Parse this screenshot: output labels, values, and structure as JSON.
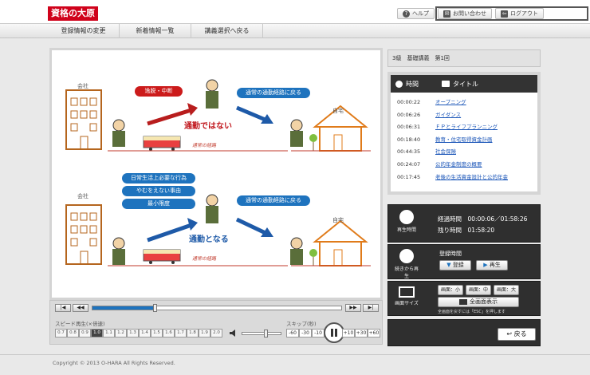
{
  "header": {
    "logo_main": "資格の大原",
    "logo_sub": "合格Web",
    "help": "ヘルプ",
    "contact": "お問い合わせ",
    "logout": "ログアウト"
  },
  "nav": [
    "登録情報の変更",
    "新着情報一覧",
    "講義選択へ戻る"
  ],
  "scene1": {
    "company": "会社",
    "home": "自宅",
    "tag_red": "逸脱・中断",
    "tag_blue": "通常の通勤経路に戻る",
    "verdict": "通勤ではない",
    "route": "通常の経路"
  },
  "scene2": {
    "company": "会社",
    "home": "自宅",
    "tag1": "日常生活上必要な行為",
    "tag2": "やむをえない事由",
    "tag3": "最小限度",
    "tag_blue": "通常の通勤経路に戻る",
    "verdict": "通勤となる",
    "route": "通常の経路"
  },
  "player": {
    "speed_label": "スピード再生(×倍速)",
    "speeds": [
      "0.7",
      "0.8",
      "0.9",
      "1.0",
      "1.1",
      "1.2",
      "1.3",
      "1.4",
      "1.5",
      "1.6",
      "1.7",
      "1.8",
      "1.9",
      "2.0"
    ],
    "active_speed": "1.0",
    "skip_label": "スキップ(秒)",
    "skips_back": [
      "-60",
      "-30",
      "-10"
    ],
    "skips_fwd": [
      "+10",
      "+30",
      "+60"
    ],
    "progress": 0.25,
    "volume": 0.6
  },
  "lecture_title": "3級　基礎講義　第1回",
  "chapters": {
    "col_time": "時間",
    "col_title": "タイトル",
    "rows": [
      {
        "time": "00:00:22",
        "title": "オープニング"
      },
      {
        "time": "00:06:26",
        "title": "ガイダンス"
      },
      {
        "time": "00:06:31",
        "title": "ＦＰとライフプランニング"
      },
      {
        "time": "00:18:40",
        "title": "教育・住宅取得資金計画"
      },
      {
        "time": "00:44:35",
        "title": "社会保険"
      },
      {
        "time": "00:24:07",
        "title": "公的年金制度の概要"
      },
      {
        "time": "00:17:45",
        "title": "老後の生活資金設計と公的年金"
      }
    ]
  },
  "playback": {
    "icon_label": "再生時間",
    "elapsed_label": "経過時間",
    "elapsed": "00:00:06／01:58:26",
    "remaining_label": "残り時間",
    "remaining": "01:58:20"
  },
  "resume": {
    "icon_label": "続きから再生",
    "reg_label": "登録時間",
    "register": "登録",
    "play": "再生"
  },
  "screen": {
    "icon_label": "画面サイズ",
    "small": "画面：小",
    "medium": "画面：中",
    "large": "画面：大",
    "full": "全画面表示",
    "note": "全画面を戻すには「ESC」を押します"
  },
  "back": "戻る",
  "footer": "Copyright © 2013 O-HARA All Rights Reserved."
}
